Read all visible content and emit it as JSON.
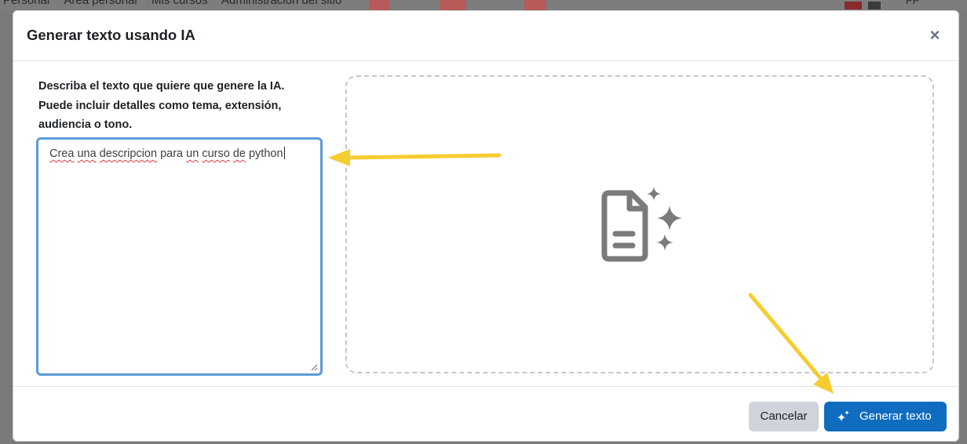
{
  "background_nav": {
    "items": [
      "Personal",
      "Área personal",
      "Mis cursos",
      "Administración del sitio"
    ],
    "user_initials": "PP"
  },
  "modal": {
    "title": "Generar texto usando IA",
    "close_symbol": "×",
    "instructions": "Describa el texto que quiere que genere la IA. Puede incluir detalles como tema, extensión, audiencia o tono.",
    "prompt": {
      "words": [
        {
          "text": "Crea",
          "misspelled": true
        },
        {
          "text": "una",
          "misspelled": true
        },
        {
          "text": "descripcion",
          "misspelled": true
        },
        {
          "text": "para",
          "misspelled": false
        },
        {
          "text": "un",
          "misspelled": true
        },
        {
          "text": "curso",
          "misspelled": true
        },
        {
          "text": "de",
          "misspelled": true
        },
        {
          "text": "python",
          "misspelled": false
        }
      ],
      "value": "Crea una descripcion para un curso de python"
    },
    "preview_icon": "ai-document-sparkle-icon",
    "footer": {
      "cancel_label": "Cancelar",
      "generate_label": "Generar texto",
      "generate_icon": "sparkle-icon"
    }
  },
  "colors": {
    "primary": "#0f6cbf",
    "secondary": "#ced4da",
    "focus_border": "#5b9bd5",
    "annotation_arrow": "#f5cd2f",
    "icon_gray": "#7a7a7a"
  },
  "annotations": [
    "arrow-to-prompt-input",
    "arrow-to-generate-button"
  ]
}
